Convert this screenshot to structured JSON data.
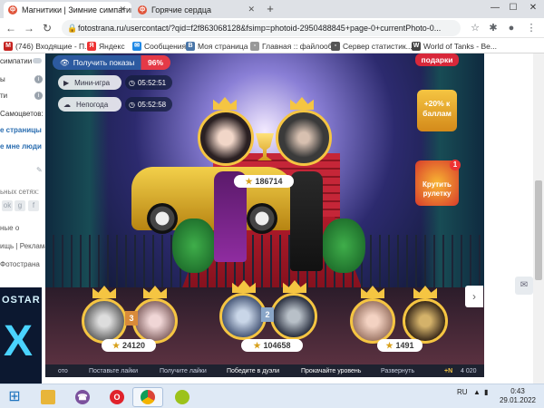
{
  "browser": {
    "tabs": [
      {
        "title": "Магнитики | Зимние симпатии",
        "active": true
      },
      {
        "title": "Горячие сердца",
        "active": false
      }
    ],
    "new_tab_label": "+",
    "window_controls": {
      "minimize": "—",
      "maximize": "☐",
      "close": "✕"
    },
    "url": "fotostrana.ru/usercontact/?qid=f2f863068128&fsimp=photoid-2950488845+page-0+currentPhoto-0...",
    "bookmarks": [
      {
        "label": "(746) Входящие - П...",
        "icon": "mail-icon",
        "color": "#c5221f"
      },
      {
        "label": "Яндекс",
        "icon": "yandex-icon",
        "color": "#e33"
      },
      {
        "label": "Сообщения",
        "icon": "chat-icon",
        "color": "#1e88e5"
      },
      {
        "label": "Моя страница",
        "icon": "vk-icon",
        "color": "#4a76a8"
      },
      {
        "label": "Главная :: файлооб...",
        "icon": "file-icon",
        "color": "#999"
      },
      {
        "label": "Сервер статистик...",
        "icon": "stats-icon",
        "color": "#555"
      },
      {
        "label": "World of Tanks - Be...",
        "icon": "wot-icon",
        "color": "#444"
      }
    ]
  },
  "sidebar": {
    "items": [
      {
        "label": "симпатии",
        "type": "plain"
      },
      {
        "label": "ы",
        "type": "badge",
        "badge": "i"
      },
      {
        "label": "ти",
        "type": "badge",
        "badge": "i"
      },
      {
        "label": "Самоцветов:",
        "type": "plain"
      },
      {
        "label": "е страницы",
        "type": "link"
      },
      {
        "label": "е мне люди",
        "type": "link"
      }
    ],
    "social_label": "ьных сетях:",
    "footer_links": [
      "ные о",
      "ищь | Реклама",
      "Фотострана"
    ],
    "banner": {
      "text": "OSTAR",
      "letter": "X"
    }
  },
  "game": {
    "promo": {
      "label": "Получить показы",
      "percent": "96%"
    },
    "mini_game": {
      "label": "Мини-игра",
      "timer": "05:52:51"
    },
    "weather": {
      "label": "Непогода",
      "timer": "05:52:58"
    },
    "side_buttons": {
      "gifts": "подарки",
      "bonus": "+20% к баллам",
      "roulette": "Крутить рулетку",
      "roulette_badge": "1"
    },
    "couple_score": "186714",
    "podium": [
      {
        "score": "24120",
        "rank": "3"
      },
      {
        "score": "104658",
        "rank": "2"
      },
      {
        "score": "1491",
        "rank": ""
      }
    ],
    "bottom_bar": [
      "ото",
      "Поставьте лайки",
      "Получите лайки",
      "Победите в дуэли",
      "Прокачайте уровень",
      "Развернуть",
      "+N",
      "4 020"
    ]
  },
  "taskbar": {
    "language": "RU",
    "time": "0:43",
    "date": "29.01.2022"
  }
}
